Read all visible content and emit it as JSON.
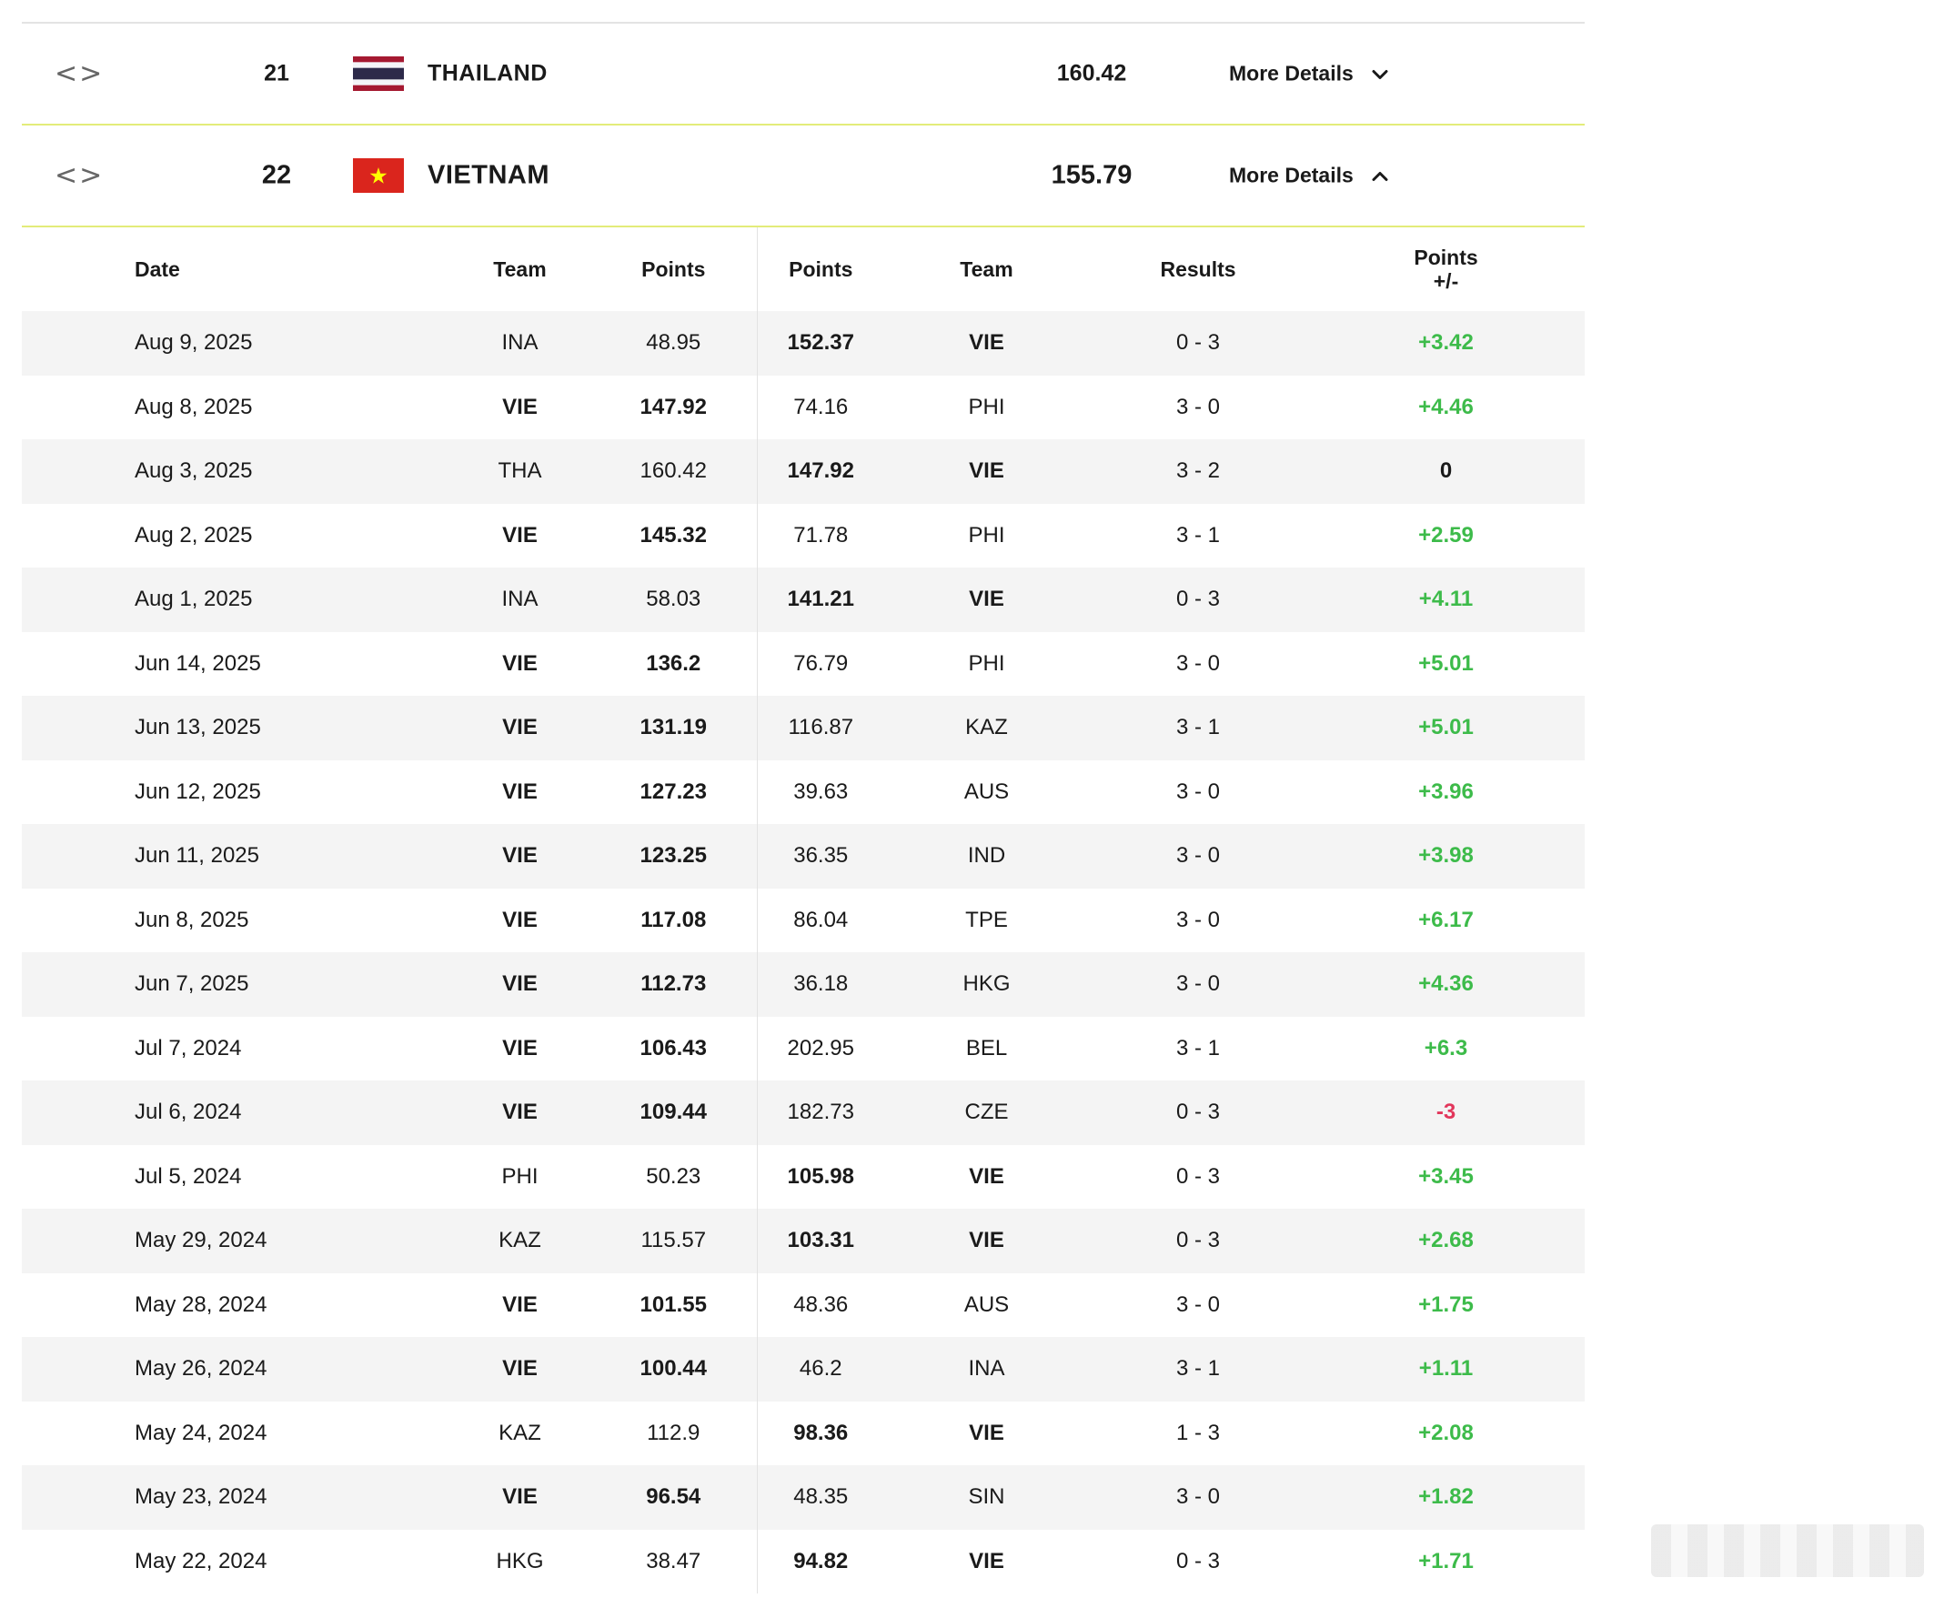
{
  "teams": [
    {
      "rank": "21",
      "name": "THAILAND",
      "points": "160.42",
      "details_label": "More Details",
      "expanded": false
    },
    {
      "rank": "22",
      "name": "VIETNAM",
      "points": "155.79",
      "details_label": "More Details",
      "expanded": true
    }
  ],
  "nav_arrows": "<>",
  "history": {
    "headers": {
      "date": "Date",
      "team1": "Team",
      "points1": "Points",
      "points2": "Points",
      "team2": "Team",
      "results": "Results",
      "delta_line1": "Points",
      "delta_line2": "+/-"
    },
    "rows": [
      {
        "date": "Aug 9, 2025",
        "team1": "INA",
        "points1": "48.95",
        "points2": "152.37",
        "team2": "VIE",
        "result": "0 - 3",
        "delta": "+3.42",
        "home_is_vie": false
      },
      {
        "date": "Aug 8, 2025",
        "team1": "VIE",
        "points1": "147.92",
        "points2": "74.16",
        "team2": "PHI",
        "result": "3 - 0",
        "delta": "+4.46",
        "home_is_vie": true
      },
      {
        "date": "Aug 3, 2025",
        "team1": "THA",
        "points1": "160.42",
        "points2": "147.92",
        "team2": "VIE",
        "result": "3 - 2",
        "delta": "0",
        "home_is_vie": false
      },
      {
        "date": "Aug 2, 2025",
        "team1": "VIE",
        "points1": "145.32",
        "points2": "71.78",
        "team2": "PHI",
        "result": "3 - 1",
        "delta": "+2.59",
        "home_is_vie": true
      },
      {
        "date": "Aug 1, 2025",
        "team1": "INA",
        "points1": "58.03",
        "points2": "141.21",
        "team2": "VIE",
        "result": "0 - 3",
        "delta": "+4.11",
        "home_is_vie": false
      },
      {
        "date": "Jun 14, 2025",
        "team1": "VIE",
        "points1": "136.2",
        "points2": "76.79",
        "team2": "PHI",
        "result": "3 - 0",
        "delta": "+5.01",
        "home_is_vie": true
      },
      {
        "date": "Jun 13, 2025",
        "team1": "VIE",
        "points1": "131.19",
        "points2": "116.87",
        "team2": "KAZ",
        "result": "3 - 1",
        "delta": "+5.01",
        "home_is_vie": true
      },
      {
        "date": "Jun 12, 2025",
        "team1": "VIE",
        "points1": "127.23",
        "points2": "39.63",
        "team2": "AUS",
        "result": "3 - 0",
        "delta": "+3.96",
        "home_is_vie": true
      },
      {
        "date": "Jun 11, 2025",
        "team1": "VIE",
        "points1": "123.25",
        "points2": "36.35",
        "team2": "IND",
        "result": "3 - 0",
        "delta": "+3.98",
        "home_is_vie": true
      },
      {
        "date": "Jun 8, 2025",
        "team1": "VIE",
        "points1": "117.08",
        "points2": "86.04",
        "team2": "TPE",
        "result": "3 - 0",
        "delta": "+6.17",
        "home_is_vie": true
      },
      {
        "date": "Jun 7, 2025",
        "team1": "VIE",
        "points1": "112.73",
        "points2": "36.18",
        "team2": "HKG",
        "result": "3 - 0",
        "delta": "+4.36",
        "home_is_vie": true
      },
      {
        "date": "Jul 7, 2024",
        "team1": "VIE",
        "points1": "106.43",
        "points2": "202.95",
        "team2": "BEL",
        "result": "3 - 1",
        "delta": "+6.3",
        "home_is_vie": true
      },
      {
        "date": "Jul 6, 2024",
        "team1": "VIE",
        "points1": "109.44",
        "points2": "182.73",
        "team2": "CZE",
        "result": "0 - 3",
        "delta": "-3",
        "home_is_vie": true
      },
      {
        "date": "Jul 5, 2024",
        "team1": "PHI",
        "points1": "50.23",
        "points2": "105.98",
        "team2": "VIE",
        "result": "0 - 3",
        "delta": "+3.45",
        "home_is_vie": false
      },
      {
        "date": "May 29, 2024",
        "team1": "KAZ",
        "points1": "115.57",
        "points2": "103.31",
        "team2": "VIE",
        "result": "0 - 3",
        "delta": "+2.68",
        "home_is_vie": false
      },
      {
        "date": "May 28, 2024",
        "team1": "VIE",
        "points1": "101.55",
        "points2": "48.36",
        "team2": "AUS",
        "result": "3 - 0",
        "delta": "+1.75",
        "home_is_vie": true
      },
      {
        "date": "May 26, 2024",
        "team1": "VIE",
        "points1": "100.44",
        "points2": "46.2",
        "team2": "INA",
        "result": "3 - 1",
        "delta": "+1.11",
        "home_is_vie": true
      },
      {
        "date": "May 24, 2024",
        "team1": "KAZ",
        "points1": "112.9",
        "points2": "98.36",
        "team2": "VIE",
        "result": "1 - 3",
        "delta": "+2.08",
        "home_is_vie": false
      },
      {
        "date": "May 23, 2024",
        "team1": "VIE",
        "points1": "96.54",
        "points2": "48.35",
        "team2": "SIN",
        "result": "3 - 0",
        "delta": "+1.82",
        "home_is_vie": true
      },
      {
        "date": "May 22, 2024",
        "team1": "HKG",
        "points1": "38.47",
        "points2": "94.82",
        "team2": "VIE",
        "result": "0 - 3",
        "delta": "+1.71",
        "home_is_vie": false
      }
    ]
  },
  "colors": {
    "positive": "#3dbb4a",
    "negative": "#e2365b",
    "row_divider": "#e3ec7a",
    "stripe": "#f4f4f4"
  }
}
